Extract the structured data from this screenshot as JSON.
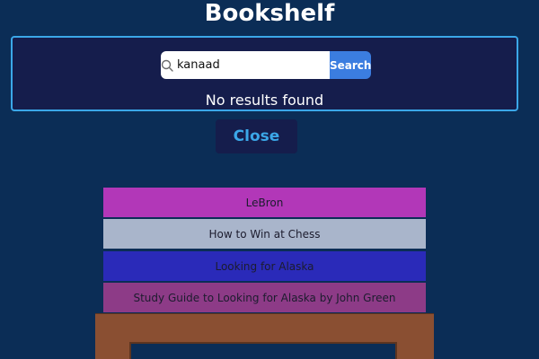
{
  "app": {
    "title": "Bookshelf"
  },
  "search": {
    "value": "kanaad",
    "button_label": "Search",
    "results_text": "No results found"
  },
  "close": {
    "label": "Close"
  },
  "books": [
    {
      "title": "LeBron",
      "color": "#b237b8"
    },
    {
      "title": "How to Win at Chess",
      "color": "#a9b5cb"
    },
    {
      "title": "Looking for Alaska",
      "color": "#2a2ab9"
    },
    {
      "title": "Study Guide to Looking for Alaska by John Green",
      "color": "#8d3b87"
    }
  ],
  "colors": {
    "background": "#0b2d56",
    "panel": "#151d4c",
    "accent": "#3ba7e8",
    "search_button": "#3b7de0",
    "shelf": "#8a4f32"
  },
  "icons": {
    "search": "search-icon"
  }
}
